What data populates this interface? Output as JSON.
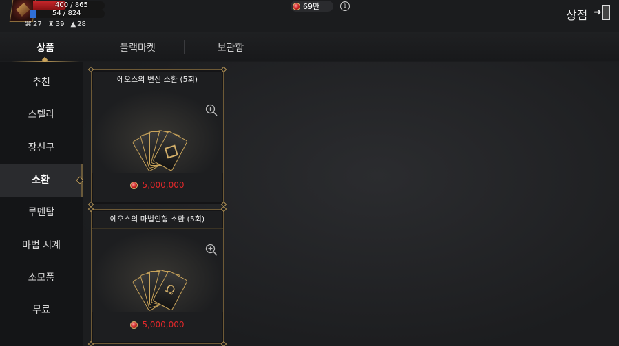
{
  "hud": {
    "hp": {
      "current": "400",
      "max": "865",
      "text": "400 / 865",
      "fraction": 0.46
    },
    "mp": {
      "current": "54",
      "max": "824",
      "text": "54 / 824",
      "fraction": 0.07
    },
    "stats": [
      {
        "icon": "fatigue-icon",
        "value": "27"
      },
      {
        "icon": "mount-icon",
        "value": "39"
      },
      {
        "icon": "boot-icon",
        "value": "28"
      }
    ],
    "currency": {
      "icon": "red-gem-icon",
      "value": "69만"
    },
    "shop_title": "상점"
  },
  "tabs": [
    {
      "label": "상품",
      "active": true
    },
    {
      "label": "블랙마켓",
      "active": false
    },
    {
      "label": "보관함",
      "active": false
    }
  ],
  "sidebar": {
    "items": [
      {
        "label": "추천"
      },
      {
        "label": "스텔라"
      },
      {
        "label": "장신구"
      },
      {
        "label": "소환",
        "active": true
      },
      {
        "label": "루멘탑"
      },
      {
        "label": "마법 시계"
      },
      {
        "label": "소모품"
      },
      {
        "label": "무료"
      }
    ]
  },
  "products": [
    {
      "title": "에오스의 변신 소환 (5회)",
      "price": "5,000,000",
      "emblem": "diamond-emblem-icon"
    },
    {
      "title": "에오스의 마법인형 소환 (5회)",
      "price": "5,000,000",
      "emblem": "omega-emblem-icon"
    }
  ],
  "colors": {
    "accent_gold": "#b89758",
    "price_red": "#e0282a",
    "hp_red": "#c6262a",
    "mp_blue": "#2f6fd6"
  }
}
